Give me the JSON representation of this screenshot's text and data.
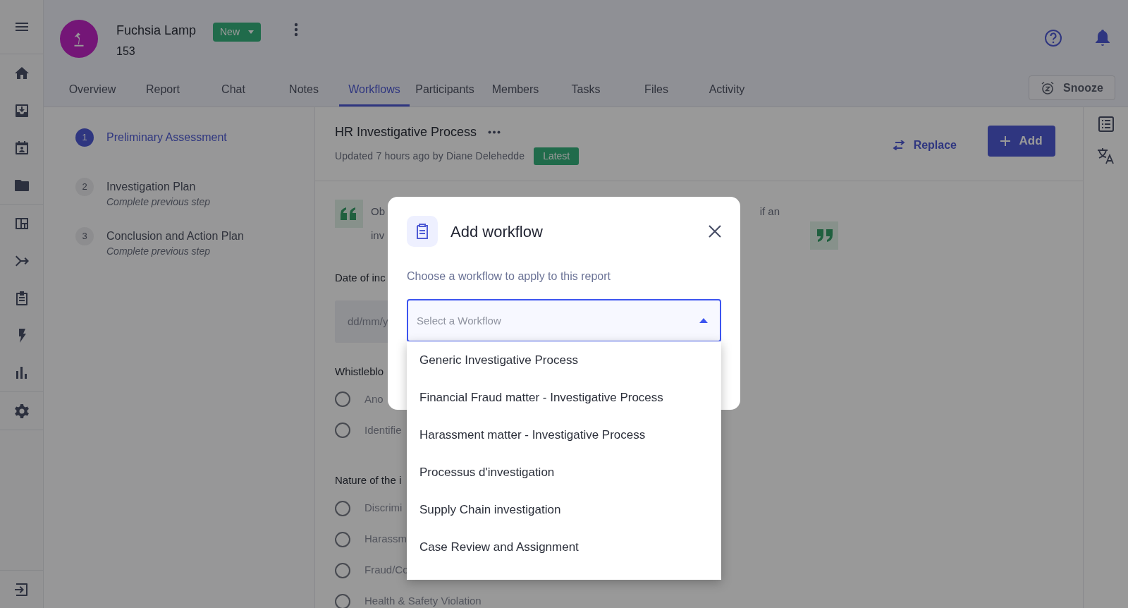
{
  "header": {
    "title": "Fuchsia Lamp",
    "number": "153",
    "status": "New"
  },
  "tabs": [
    {
      "label": "Overview",
      "selected": false
    },
    {
      "label": "Report",
      "selected": false
    },
    {
      "label": "Chat",
      "selected": false
    },
    {
      "label": "Notes",
      "selected": false
    },
    {
      "label": "Workflows",
      "selected": true
    },
    {
      "label": "Participants",
      "selected": false
    },
    {
      "label": "Members",
      "selected": false
    },
    {
      "label": "Tasks",
      "selected": false
    },
    {
      "label": "Files",
      "selected": false
    },
    {
      "label": "Activity",
      "selected": false
    }
  ],
  "snooze": "Snooze",
  "steps": [
    {
      "number": "1",
      "title": "Preliminary Assessment",
      "selected": true
    },
    {
      "number": "2",
      "title": "Investigation Plan",
      "subtitle": "Complete previous step",
      "selected": false
    },
    {
      "number": "3",
      "title": "Conclusion and Action Plan",
      "subtitle": "Complete previous step",
      "selected": false
    }
  ],
  "workflow": {
    "title": "HR Investigative Process",
    "updated": "Updated 7 hours ago by Diane Delehedde",
    "badge": "Latest",
    "replace": "Replace",
    "add": "Add"
  },
  "form": {
    "quote": {
      "line_1_start": "Ob",
      "line_1_end": "if an",
      "line_2": "inv"
    },
    "date": {
      "label": "Date of inc",
      "placeholder": "dd/mm/y"
    },
    "groups": [
      {
        "label": "Whistleblo",
        "options": [
          {
            "label": "Ano",
            "checked": false
          },
          {
            "label": "Identifie",
            "checked": false
          }
        ]
      },
      {
        "label": "Nature of the i",
        "options": [
          {
            "label": "Discrimi",
            "checked": false
          },
          {
            "label": "Harassm",
            "checked": false
          },
          {
            "label": "Fraud/Co",
            "checked": false
          },
          {
            "label": "Health & Safety Violation",
            "checked": false
          }
        ]
      }
    ]
  },
  "modal": {
    "title": "Add workflow",
    "subtitle": "Choose a workflow to apply to this report",
    "select": {
      "placeholder": "Select a Workflow",
      "expanded": true
    },
    "options": [
      "Generic Investigative Process",
      "Financial Fraud matter - Investigative Process",
      "Harassment matter - Investigative Process",
      "Processus d'investigation",
      "Supply Chain investigation",
      "Case Review and Assignment"
    ]
  }
}
